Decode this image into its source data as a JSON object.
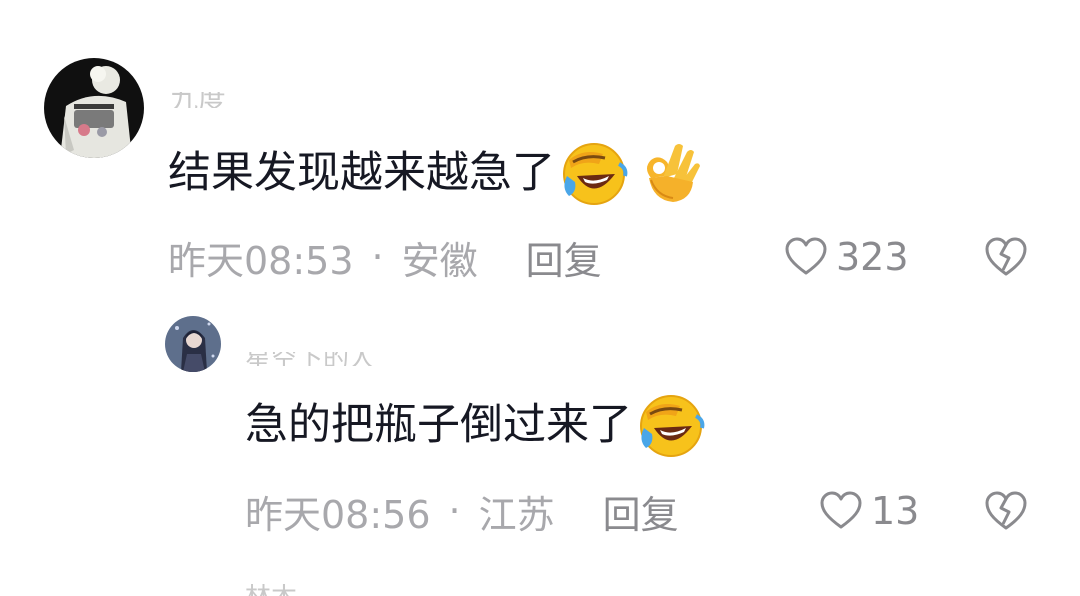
{
  "comments": [
    {
      "username": "九度",
      "text": "结果发现越来越急了",
      "emojis": [
        "laughing-crying-emoji",
        "ok-hand-emoji"
      ],
      "time": "昨天08:53",
      "separator": "·",
      "location": "安徽",
      "reply_label": "回复",
      "likes": "323"
    },
    {
      "username": "星空下的人",
      "text": "急的把瓶子倒过来了",
      "emojis": [
        "laughing-crying-emoji"
      ],
      "time": "昨天08:56",
      "separator": "·",
      "location": "江苏",
      "reply_label": "回复",
      "likes": "13"
    }
  ],
  "next_comment": {
    "username": "林木"
  },
  "colors": {
    "text": "#161823",
    "meta": "#a8a8ac",
    "action": "#8a8a8e",
    "username": "#c9c9c9"
  }
}
